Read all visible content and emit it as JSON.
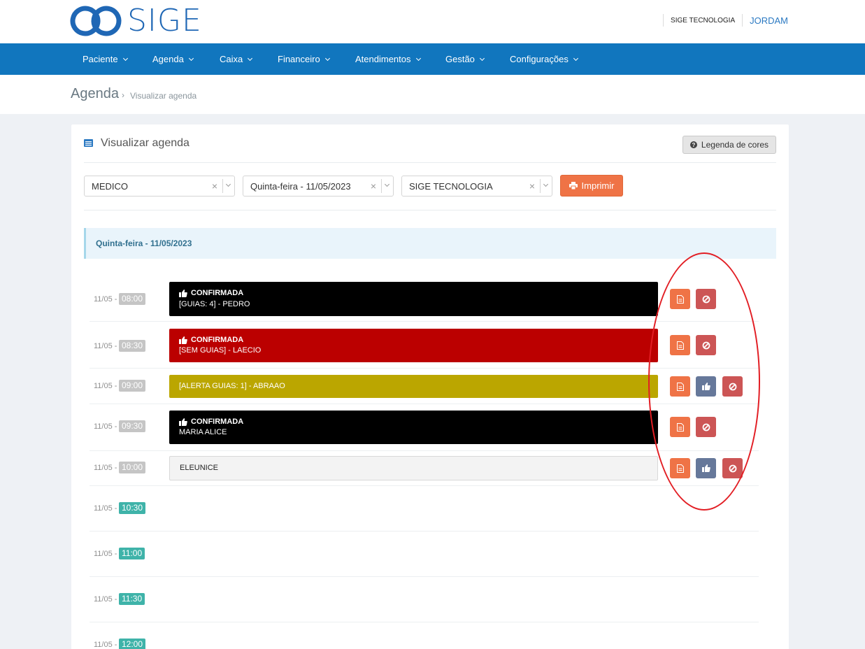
{
  "brand": {
    "logo_text": "SIGE"
  },
  "top_bar": {
    "company": "SIGE TECNOLOGIA",
    "user": "JORDAM"
  },
  "nav": {
    "items": [
      {
        "label": "Paciente"
      },
      {
        "label": "Agenda"
      },
      {
        "label": "Caixa"
      },
      {
        "label": "Financeiro"
      },
      {
        "label": "Atendimentos"
      },
      {
        "label": "Gestão"
      },
      {
        "label": "Configurações"
      }
    ]
  },
  "breadcrumb": {
    "title": "Agenda",
    "separator": "›",
    "current": "Visualizar agenda"
  },
  "panel": {
    "title": "Visualizar agenda",
    "legend_button": "Legenda de cores"
  },
  "filters": {
    "professional": "MEDICO",
    "date": "Quinta-feira - 11/05/2023",
    "company": "SIGE TECNOLOGIA",
    "clear_symbol": "×",
    "print_button": "Imprimir"
  },
  "day": {
    "label": "Quinta-feira - 11/05/2023"
  },
  "slots": [
    {
      "date": "11/05 -",
      "time": "08:00",
      "status": "CONFIRMADA",
      "text": "[GUIAS: 4] - PEDRO",
      "color": "#000000",
      "actions": [
        "document",
        "cancel"
      ]
    },
    {
      "date": "11/05 -",
      "time": "08:30",
      "status": "CONFIRMADA",
      "text": "[SEM GUIAS] - LAECIO",
      "color": "#bb0000",
      "actions": [
        "document",
        "cancel"
      ]
    },
    {
      "date": "11/05 -",
      "time": "09:00",
      "status": "",
      "text": "[ALERTA GUIAS: 1] - ABRAAO",
      "color": "#bba600",
      "actions": [
        "document",
        "confirm",
        "cancel"
      ]
    },
    {
      "date": "11/05 -",
      "time": "09:30",
      "status": "CONFIRMADA",
      "text": "MARIA ALICE",
      "color": "#000000",
      "actions": [
        "document",
        "cancel"
      ]
    },
    {
      "date": "11/05 -",
      "time": "10:00",
      "status": "",
      "text": "ELEUNICE",
      "color": "#f3f3f3",
      "actions": [
        "document",
        "confirm",
        "cancel"
      ]
    },
    {
      "date": "11/05 -",
      "time": "10:30"
    },
    {
      "date": "11/05 -",
      "time": "11:00"
    },
    {
      "date": "11/05 -",
      "time": "11:30"
    },
    {
      "date": "11/05 -",
      "time": "12:00"
    }
  ],
  "colors": {
    "nav_bg": "#1176be",
    "accent_orange": "#ef7346",
    "confirm_button": "#66789a",
    "cancel_button": "#cc5555",
    "free_slot": "#3fb3a9",
    "busy_slot": "#c5c5c5",
    "highlight_circle": "#e21e24"
  }
}
